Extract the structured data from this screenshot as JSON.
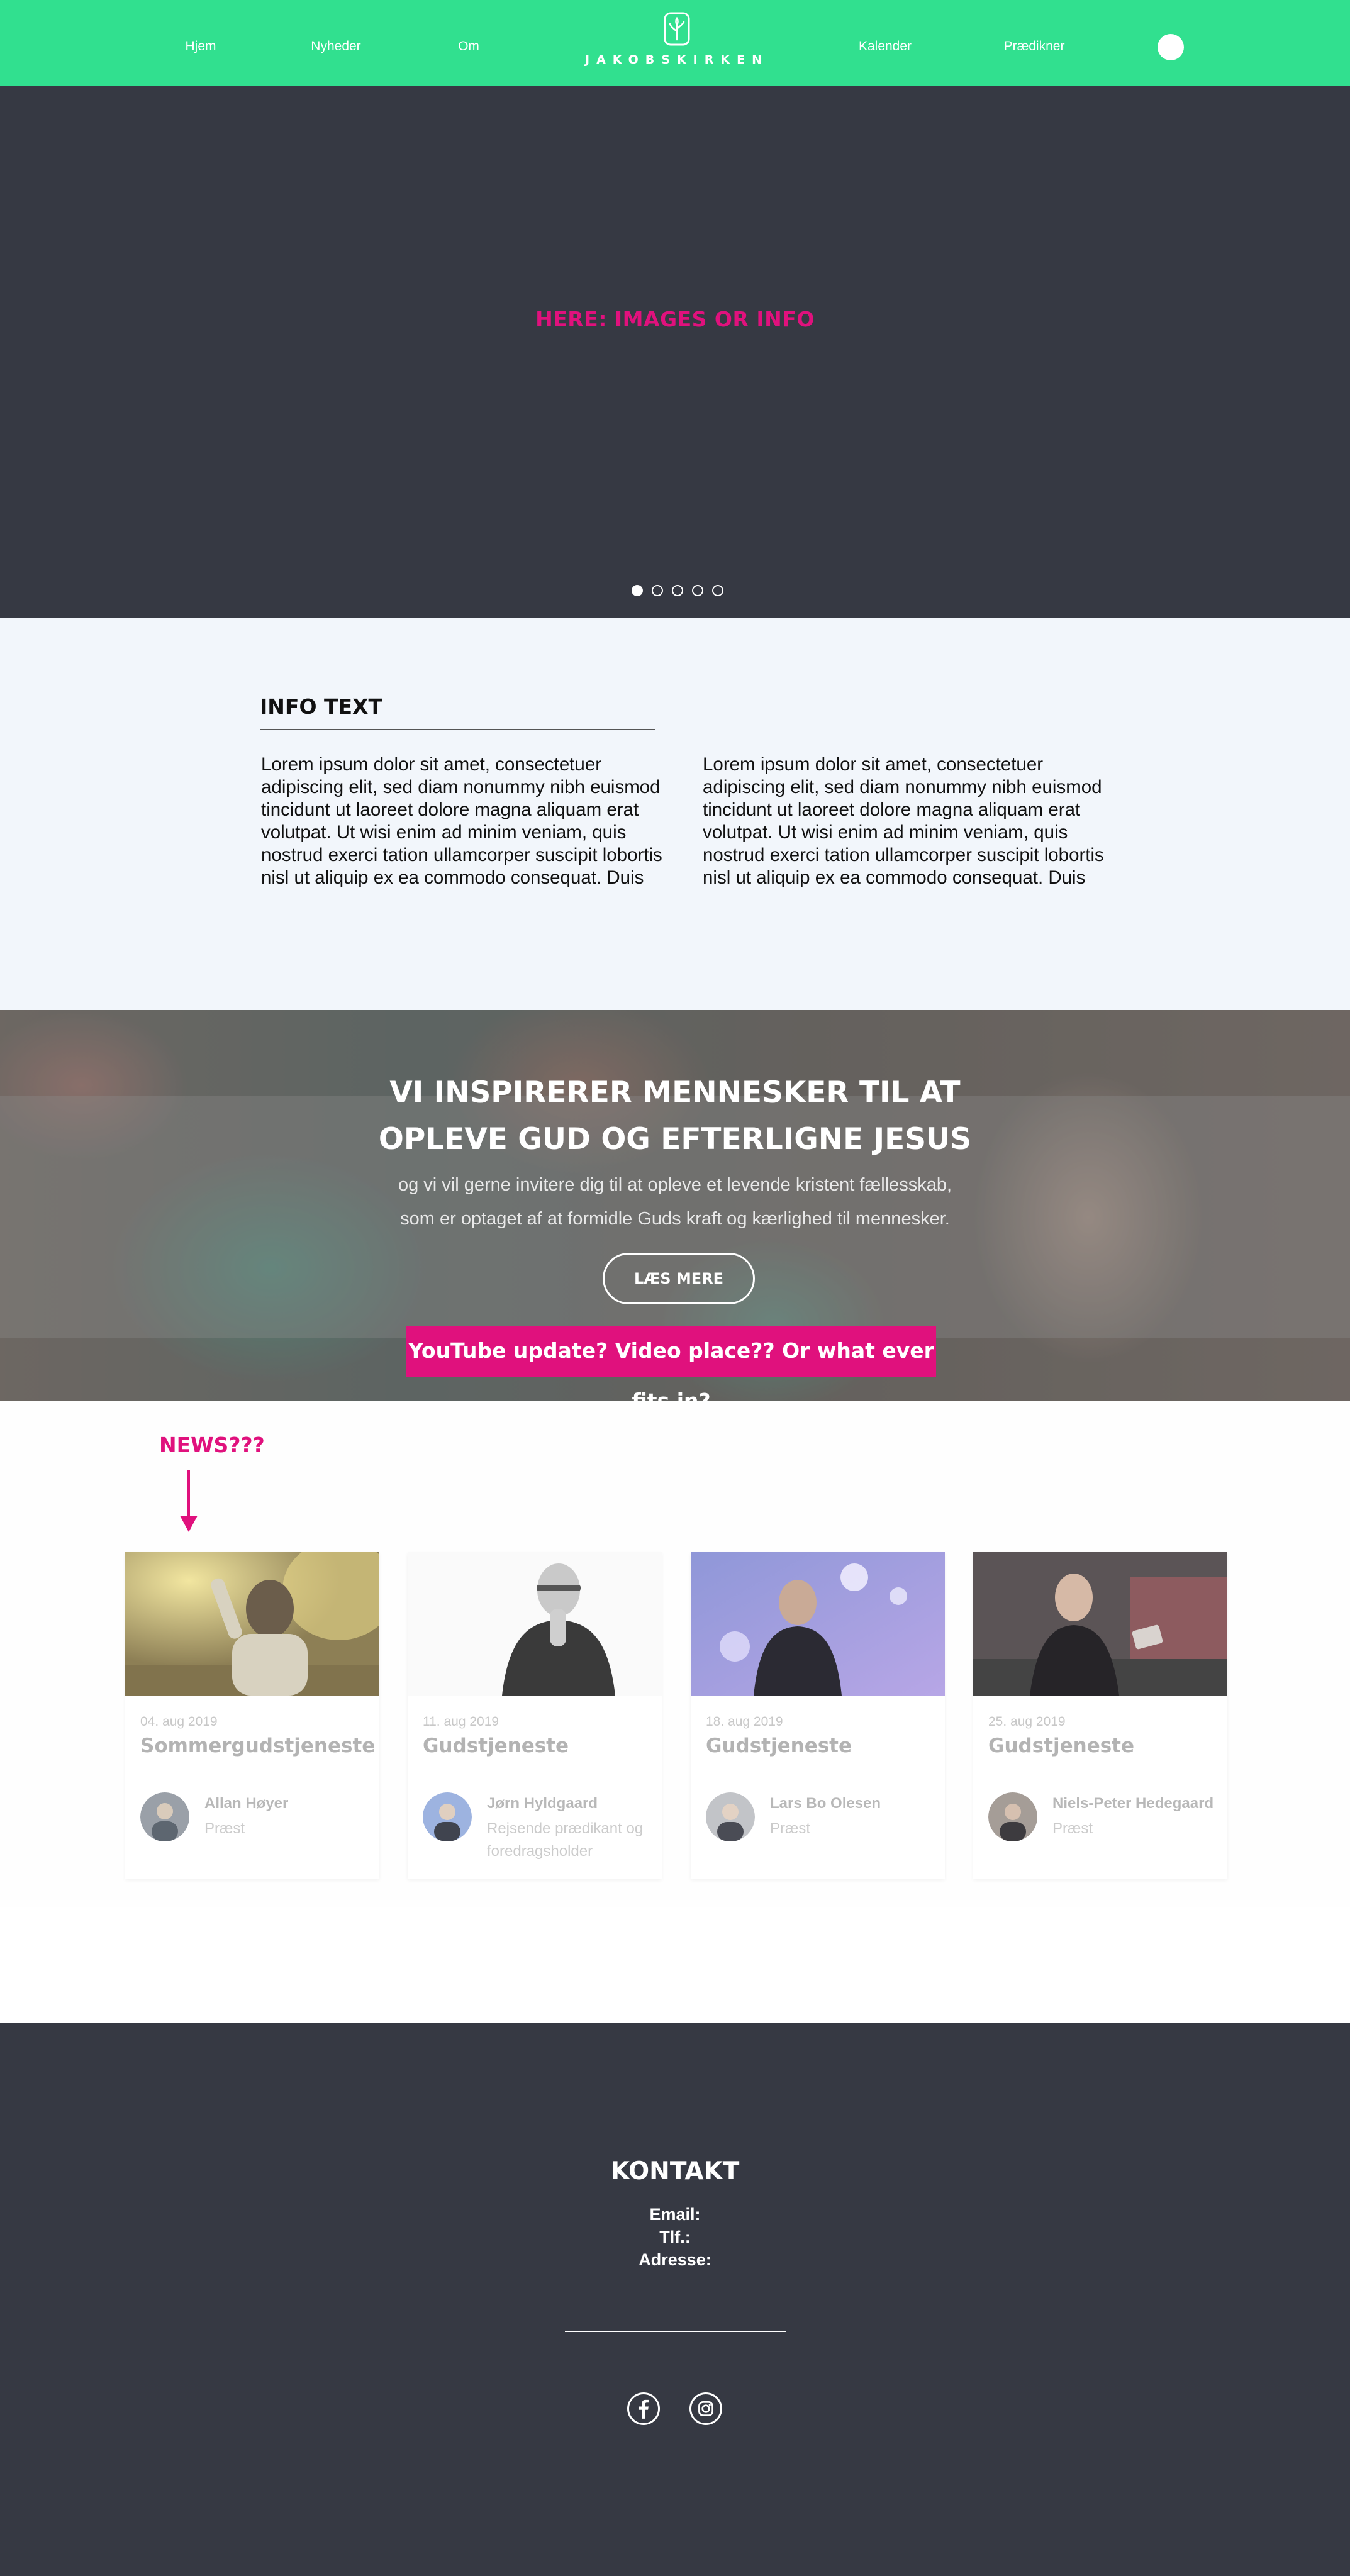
{
  "nav": {
    "links_left": [
      "Hjem",
      "Nyheder",
      "Om"
    ],
    "logo_text": "JAKOBSKIRKEN",
    "links_right": [
      "Kalender",
      "Prædikner"
    ],
    "bg_color": "#31e08f"
  },
  "hero": {
    "placeholder": "HERE: IMAGES OR INFO",
    "slide_count": 5,
    "active_slide": 1,
    "bg_color": "#363943"
  },
  "info": {
    "title": "INFO TEXT",
    "col1": "Lorem ipsum dolor sit amet, consectetuer adipiscing elit, sed diam nonummy nibh euismod tincidunt ut laoreet dolore magna aliquam erat volutpat. Ut wisi enim ad minim veniam, quis nostrud exerci tation ullamcorper suscipit lobortis nisl ut aliquip ex ea commodo consequat. Duis",
    "col2": "Lorem ipsum dolor sit amet, consectetuer adipiscing elit, sed diam nonummy nibh euismod tincidunt ut laoreet dolore magna aliquam erat volutpat. Ut wisi enim ad minim veniam, quis nostrud exerci tation ullamcorper suscipit lobortis nisl ut aliquip ex ea commodo consequat. Duis"
  },
  "banner": {
    "heading_line1": "VI INSPIRERER MENNESKER TIL AT",
    "heading_line2": "OPLEVE GUD OG EFTERLIGNE JESUS",
    "text_line1": "og vi vil gerne invitere dig til at opleve et levende kristent fællesskab,",
    "text_line2": "som er optaget af at formidle Guds kraft og kærlighed til mennesker.",
    "button": "LÆS MERE",
    "youtube_note": "YouTube update? Video place?? Or what ever fits in?",
    "accent_color": "#e0117d"
  },
  "news": {
    "label": "NEWS???",
    "cards": [
      {
        "date": "04. aug 2019",
        "title": "Sommergudstjeneste",
        "name": "Allan Høyer",
        "role": "Præst"
      },
      {
        "date": "11. aug 2019",
        "title": "Gudstjeneste",
        "name": "Jørn Hyldgaard",
        "role": "Rejsende prædikant og foredragsholder"
      },
      {
        "date": "18. aug 2019",
        "title": "Gudstjeneste",
        "name": "Lars Bo Olesen",
        "role": "Præst"
      },
      {
        "date": "25. aug 2019",
        "title": "Gudstjeneste",
        "name": "Niels-Peter Hedegaard",
        "role": "Præst"
      }
    ]
  },
  "footer": {
    "title": "KONTAKT",
    "email_label": "Email:",
    "phone_label": "Tlf.:",
    "address_label": "Adresse:",
    "social_icons": [
      "facebook-icon",
      "instagram-icon"
    ]
  }
}
